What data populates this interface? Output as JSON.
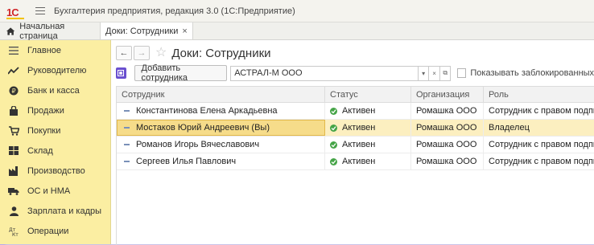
{
  "app": {
    "logo_text": "1С",
    "title": "Бухгалтерия предприятия, редакция 3.0  (1С:Предприятие)"
  },
  "tabs": [
    {
      "label": "Начальная страница",
      "icon": "home-icon"
    },
    {
      "label": "Доки: Сотрудники",
      "close": "×"
    }
  ],
  "sidebar": {
    "items": [
      {
        "label": "Главное",
        "icon": "menu-lines-icon"
      },
      {
        "label": "Руководителю",
        "icon": "trend-icon"
      },
      {
        "label": "Банк и касса",
        "icon": "coin-icon"
      },
      {
        "label": "Продажи",
        "icon": "bag-icon"
      },
      {
        "label": "Покупки",
        "icon": "cart-icon"
      },
      {
        "label": "Склад",
        "icon": "warehouse-icon"
      },
      {
        "label": "Производство",
        "icon": "factory-icon"
      },
      {
        "label": "ОС и НМА",
        "icon": "truck-icon"
      },
      {
        "label": "Зарплата и кадры",
        "icon": "person-icon"
      },
      {
        "label": "Операции",
        "icon": "operations-icon"
      }
    ]
  },
  "form": {
    "title": "Доки: Сотрудники",
    "back": "←",
    "forward": "→",
    "star": "☆",
    "add_button": "Добавить сотрудника",
    "org_value": "АСТРАЛ-М ООО",
    "org_dropdown": "▾",
    "org_clear": "×",
    "org_open": "⧉",
    "show_blocked_label": "Показывать заблокированных",
    "show_blocked": false
  },
  "table": {
    "columns": [
      "Сотрудник",
      "Статус",
      "Организация",
      "Роль"
    ],
    "rows": [
      {
        "employee": "Константинова Елена Аркадьевна",
        "status": "Активен",
        "org": "Ромашка ООО",
        "role": "Сотрудник с правом подписи",
        "selected": false
      },
      {
        "employee": "Мостаков Юрий Андреевич (Вы)",
        "status": "Активен",
        "org": "Ромашка ООО",
        "role": "Владелец",
        "selected": true
      },
      {
        "employee": "Романов Игорь Вячеславович",
        "status": "Активен",
        "org": "Ромашка ООО",
        "role": "Сотрудник с правом подписи",
        "selected": false
      },
      {
        "employee": "Сергеев Илья Павлович",
        "status": "Активен",
        "org": "Ромашка ООО",
        "role": "Сотрудник с правом подписи",
        "selected": false
      }
    ]
  },
  "colors": {
    "sidebar_bg": "#fbeea2",
    "selected_row": "#fcefc0",
    "status_ok": "#45a447",
    "accent_button": "#6a4fcf",
    "logo_red": "#d0262a"
  }
}
